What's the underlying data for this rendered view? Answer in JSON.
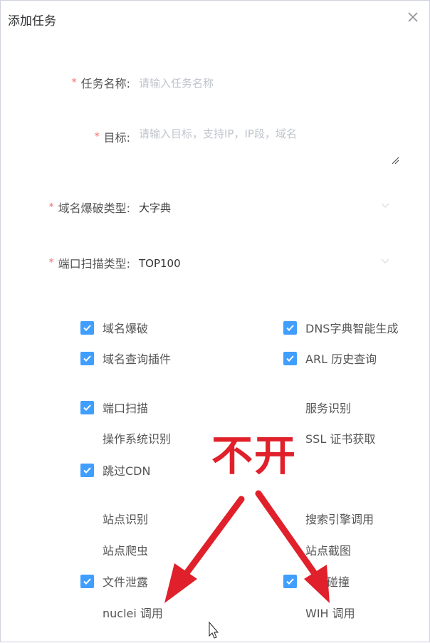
{
  "dialog": {
    "title": "添加任务"
  },
  "form": {
    "task_name": {
      "label": "任务名称:",
      "placeholder": "请输入任务名称"
    },
    "target": {
      "label": "目标:",
      "placeholder": "请输入目标，支持IP，IP段，域名"
    },
    "domain_brute_type": {
      "label": "域名爆破类型:",
      "value": "大字典"
    },
    "port_scan_type": {
      "label": "端口扫描类型:",
      "value": "TOP100"
    }
  },
  "options": {
    "domain_brute": {
      "label": "域名爆破",
      "checked": true
    },
    "dns_dict": {
      "label": "DNS字典智能生成",
      "checked": true
    },
    "domain_plugin": {
      "label": "域名查询插件",
      "checked": true
    },
    "arl_history": {
      "label": "ARL 历史查询",
      "checked": true
    },
    "port_scan": {
      "label": "端口扫描",
      "checked": true
    },
    "service_detect": {
      "label": "服务识别",
      "checked": false
    },
    "os_detect": {
      "label": "操作系统识别",
      "checked": false
    },
    "ssl_cert": {
      "label": "SSL 证书获取",
      "checked": false
    },
    "skip_cdn": {
      "label": "跳过CDN",
      "checked": true
    },
    "site_detect": {
      "label": "站点识别",
      "checked": false
    },
    "search_engine": {
      "label": "搜索引擎调用",
      "checked": false
    },
    "site_crawler": {
      "label": "站点爬虫",
      "checked": false
    },
    "site_screenshot": {
      "label": "站点截图",
      "checked": false
    },
    "file_leak": {
      "label": "文件泄露",
      "checked": true
    },
    "host_collision": {
      "label": "碰撞",
      "checked": true
    },
    "nuclei": {
      "label": "nuclei 调用",
      "checked": false
    },
    "wih": {
      "label": "WIH 调用",
      "checked": false
    }
  },
  "annotation": {
    "text": "不开",
    "color": "#e0202a"
  },
  "colors": {
    "accent": "#409eff",
    "required": "#f56c6c"
  }
}
